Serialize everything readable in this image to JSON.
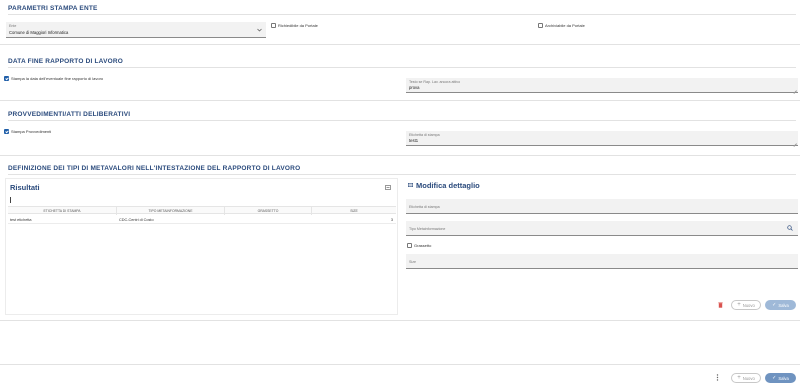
{
  "parametri": {
    "title": "PARAMETRI STAMPA ENTE",
    "ente_label": "Ente",
    "ente_value": "Comune di Maggiori Informatica",
    "richiedibile_label": "Richiedibile da Portale",
    "archiviabile_label": "Archiviabile da Portale"
  },
  "data_fine": {
    "title": "DATA FINE RAPPORTO DI LAVORO",
    "checkbox_label": "Stampa la data dell'eventuale fine rapporto di lavoro",
    "testo_label": "Testo se Rap. Lav. ancora attivo",
    "testo_value": "prova"
  },
  "provvedimenti": {
    "title": "PROVVEDIMENTI/ATTI DELIBERATIVI",
    "checkbox_label": "Stampa Provvedimenti",
    "etichetta_label": "Etichetta di stampa",
    "etichetta_value": "test1"
  },
  "definizione": {
    "title": "DEFINIZIONE DEI TIPI DI METAVALORI NELL'INTESTAZIONE DEL RAPPORTO DI LAVORO"
  },
  "risultati": {
    "title": "Risultati",
    "columns": [
      "ETICHETTA DI STAMPA",
      "TIPO METAINFORMAZIONE",
      "GRASSETTO",
      "SIZE"
    ],
    "rows": [
      {
        "etichetta": "test etichetta",
        "tipo": "CDC-Centri di Costo",
        "grassetto": "",
        "size": "3"
      }
    ]
  },
  "modifica": {
    "title": "Modifica dettaglio",
    "etichetta_label": "Etichetta di stampa",
    "tipo_label": "Tipo Metainformazione",
    "grassetto_label": "Grassetto",
    "size_label": "Size",
    "nuovo_label": "Nuovo",
    "salva_label": "Salva"
  },
  "footer": {
    "nuovo_label": "Nuovo",
    "salva_label": "Salva"
  },
  "colors": {
    "accent": "#2a4a7c",
    "checkbox": "#1f5ea8",
    "primary_disabled": "#9fb9d8",
    "delete": "#d9534f"
  }
}
